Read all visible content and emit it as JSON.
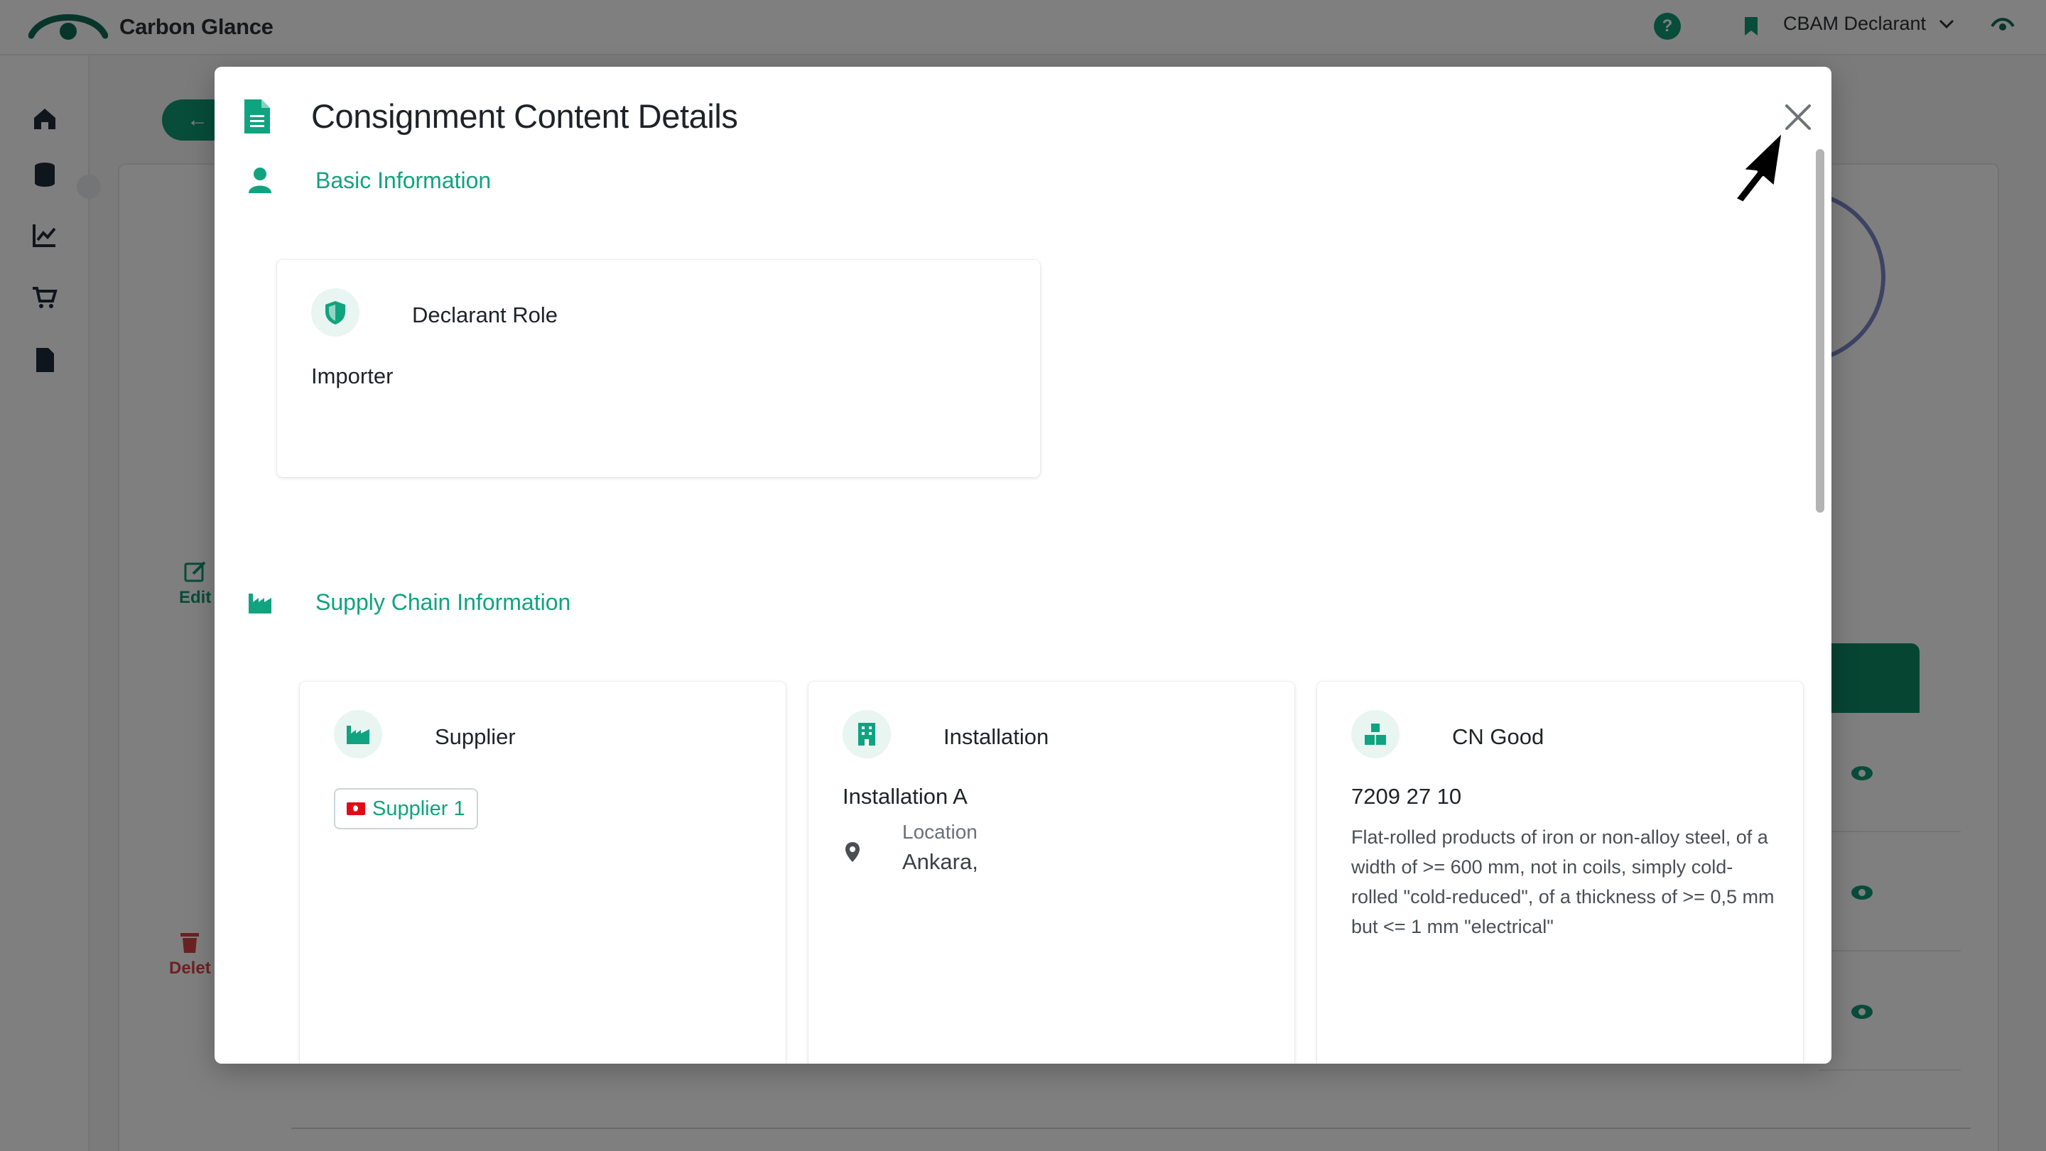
{
  "app": {
    "title": "Carbon Glance",
    "role_selector": "CBAM Declarant",
    "colors": {
      "brand": "#0f9a73",
      "accent_text": "#10a37f",
      "danger": "#d64545"
    }
  },
  "background": {
    "edit_label": "Edit",
    "delete_label": "Delet"
  },
  "modal": {
    "title": "Consignment Content Details",
    "close_icon": "close-icon",
    "sections": {
      "basic": {
        "heading": "Basic Information",
        "declarant_role": {
          "label": "Declarant Role",
          "value": "Importer"
        }
      },
      "supply_chain": {
        "heading": "Supply Chain Information",
        "supplier": {
          "label": "Supplier",
          "chip": "Supplier 1"
        },
        "installation": {
          "label": "Installation",
          "name": "Installation A",
          "location_label": "Location",
          "location_value": "Ankara,"
        },
        "cn_good": {
          "label": "CN Good",
          "code": "7209 27 10",
          "description": "Flat-rolled products of iron or non-alloy steel, of a width of >= 600 mm, not in coils, simply cold-rolled \"cold-reduced\", of a thickness of >= 0,5 mm but <= 1 mm \"electrical\""
        }
      }
    }
  }
}
